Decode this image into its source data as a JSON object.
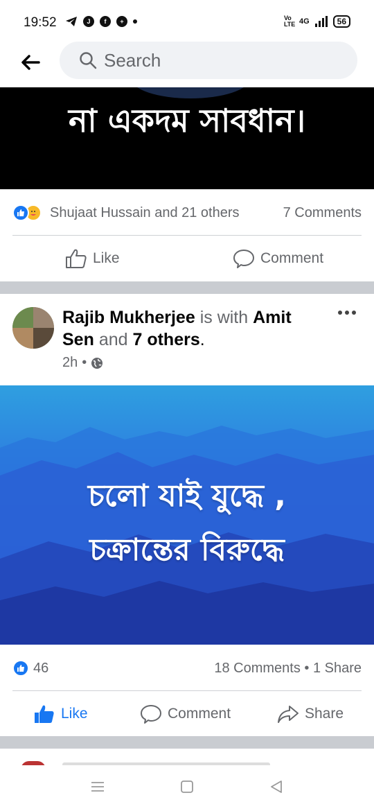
{
  "status_bar": {
    "time": "19:52",
    "network": "4G",
    "volte": "Vo LTE",
    "battery": "56"
  },
  "header": {
    "search_placeholder": "Search"
  },
  "post1": {
    "image_text": "না একদম সাবধান।",
    "reactions_text": "Shujaat Hussain and 21 others",
    "comments_text": "7 Comments",
    "actions": {
      "like": "Like",
      "comment": "Comment"
    }
  },
  "post2": {
    "author": "Rajib Mukherjee",
    "is_with": "is with",
    "tagged_1": "Amit",
    "tagged_1b": "Sen",
    "and_text": "and",
    "tagged_others": "7 others",
    "period": ".",
    "time": "2h",
    "privacy_icon": "globe-icon",
    "image_line_1": "চলো যাই যুদ্ধে ,",
    "image_line_2": "চক্রান্তের বিরুদ্ধে",
    "likes_count": "46",
    "comments_shares": "18 Comments • 1 Share",
    "actions": {
      "like": "Like",
      "comment": "Comment",
      "share": "Share"
    }
  },
  "colors": {
    "brand_blue": "#1877f2",
    "muted_text": "#65676b",
    "separator": "#c9ccd1"
  }
}
